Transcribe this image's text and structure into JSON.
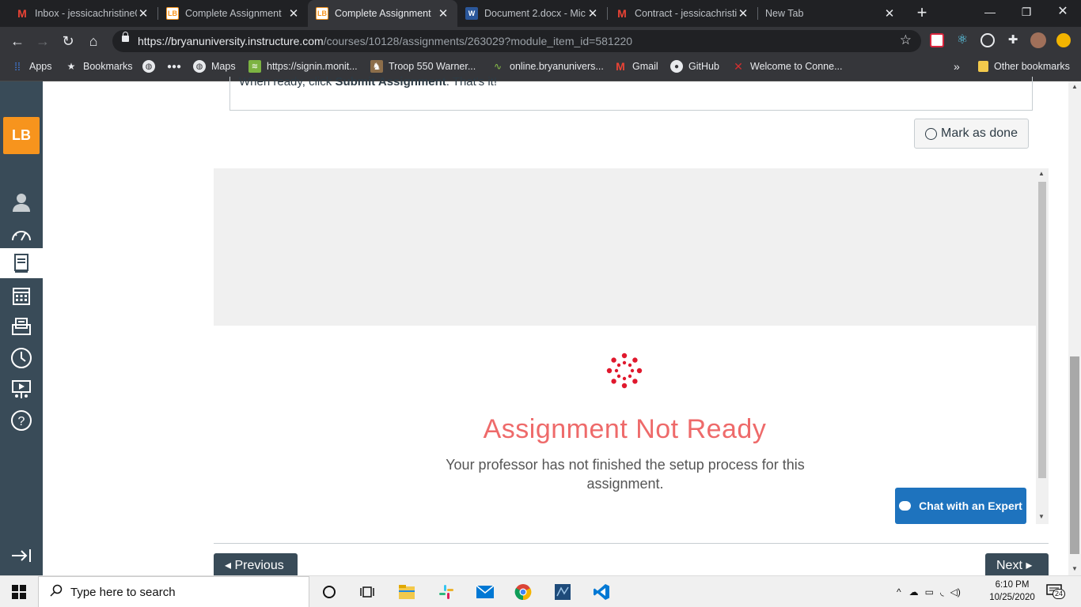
{
  "browser": {
    "tabs": [
      {
        "title": "Inbox - jessicachristine0",
        "icon": "gmail-icon"
      },
      {
        "title": "Complete Assignment",
        "icon": "lb-icon"
      },
      {
        "title": "Complete Assignment",
        "icon": "lb-icon",
        "active": true
      },
      {
        "title": "Document 2.docx - Mic",
        "icon": "word-icon"
      },
      {
        "title": "Contract - jessicachristi",
        "icon": "gmail-icon"
      },
      {
        "title": "New Tab",
        "icon": ""
      }
    ],
    "url_host": "https://bryanuniversity.instructure.com",
    "url_path": "/courses/10128/assignments/263029?module_item_id=581220",
    "bookmarks": [
      {
        "label": "Apps",
        "icon": "apps-grid-icon"
      },
      {
        "label": "Bookmarks",
        "icon": "star-icon"
      },
      {
        "label": "",
        "icon": "globe-icon"
      },
      {
        "label": "",
        "icon": "people-icon"
      },
      {
        "label": "Maps",
        "icon": "globe-icon"
      },
      {
        "label": "https://signin.monit...",
        "icon": "wifi-icon"
      },
      {
        "label": "Troop 550 Warner...",
        "icon": "troop-icon"
      },
      {
        "label": "online.bryanunivers...",
        "icon": "bryan-icon"
      },
      {
        "label": "Gmail",
        "icon": "gmail-icon"
      },
      {
        "label": "GitHub",
        "icon": "github-icon"
      },
      {
        "label": "Welcome to Conne...",
        "icon": "connect-icon"
      }
    ],
    "bookmarks_overflow": "»",
    "other_bookmarks": "Other bookmarks"
  },
  "lms": {
    "logo_text": "LB",
    "instruction_prefix": "When ready, click ",
    "instruction_bold": "Submit Assignment",
    "instruction_suffix": ". That's it!",
    "mark_as_done": "Mark as done",
    "not_ready_title": "Assignment Not Ready",
    "not_ready_text": "Your professor has not finished the setup process for this assignment.",
    "chat_label": "Chat with an Expert",
    "previous_label": "◂ Previous",
    "next_label": "Next ▸"
  },
  "taskbar": {
    "search_placeholder": "Type here to search",
    "time": "6:10 PM",
    "date": "10/25/2020",
    "notifications": "24"
  },
  "colors": {
    "nav_bg": "#394b58",
    "logo_bg": "#f7941d",
    "not_ready_red": "#ee6a6a",
    "canvas_red": "#e0182d",
    "chat_blue": "#1e73be"
  }
}
